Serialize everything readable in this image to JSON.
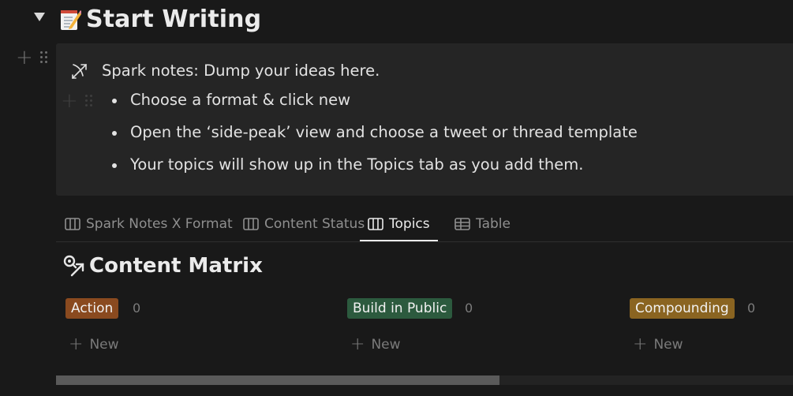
{
  "page": {
    "title": "Start Writing",
    "title_emoji": "memo-icon"
  },
  "callout": {
    "icon": "bow-arrow-icon",
    "title": "Spark notes: Dump your ideas here.",
    "bullets": [
      "Choose a format & click new",
      "Open the ‘side-peak’ view and choose a tweet or thread template",
      "Your topics will show up in the Topics tab as you add them."
    ]
  },
  "tabs": [
    {
      "label": "Spark Notes X Format",
      "icon": "board-icon",
      "active": false
    },
    {
      "label": "Content Status",
      "icon": "board-icon",
      "active": false
    },
    {
      "label": "Topics",
      "icon": "board-icon",
      "active": true
    },
    {
      "label": "Table",
      "icon": "table-icon",
      "active": false
    }
  ],
  "matrix": {
    "title": "Content Matrix",
    "icon": "key-arrow-icon",
    "columns": [
      {
        "label": "Action",
        "count": "0",
        "color": "#8a4a1f",
        "new_label": "New"
      },
      {
        "label": "Build in Public",
        "count": "0",
        "color": "#2c5a3e",
        "new_label": "New"
      },
      {
        "label": "Compounding",
        "count": "0",
        "color": "#8a6421",
        "new_label": "New"
      }
    ]
  },
  "scrollbar": {
    "position_fraction": 0.6
  }
}
